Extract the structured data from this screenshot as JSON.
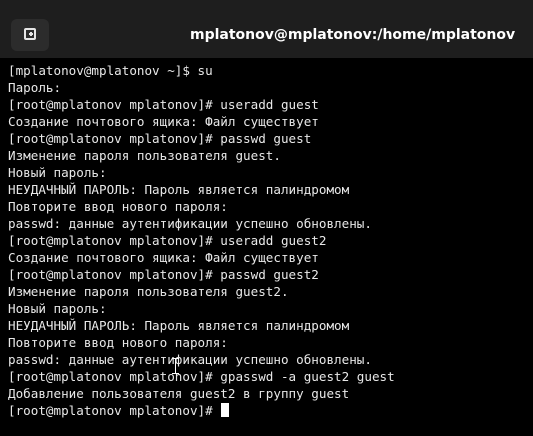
{
  "window": {
    "title": "mplatonov@mplatonov:/home/mplatonov",
    "new_tab_icon": "new-tab-icon"
  },
  "terminal": {
    "lines": [
      "[mplatonov@mplatonov ~]$ su",
      "Пароль:",
      "[root@mplatonov mplatonov]# useradd guest",
      "Создание почтового ящика: Файл существует",
      "[root@mplatonov mplatonov]# passwd guest",
      "Изменение пароля пользователя guest.",
      "Новый пароль:",
      "НЕУДАЧНЫЙ ПАРОЛЬ: Пароль является палиндромом",
      "Повторите ввод нового пароля:",
      "passwd: данные аутентификации успешно обновлены.",
      "[root@mplatonov mplatonov]# useradd guest2",
      "Создание почтового ящика: Файл существует",
      "[root@mplatonov mplatonov]# passwd guest2",
      "Изменение пароля пользователя guest2.",
      "Новый пароль:",
      "НЕУДАЧНЫЙ ПАРОЛЬ: Пароль является палиндромом",
      "Повторите ввод нового пароля:",
      "passwd: данные аутентификации успешно обновлены.",
      "[root@mplatonov mplatonov]# gpasswd -a guest2 guest",
      "Добавление пользователя guest2 в группу guest",
      "[root@mplatonov mplatonov]# "
    ]
  },
  "colors": {
    "background": "#000000",
    "titlebar": "#1e1e1e",
    "text": "#e8e8e8"
  }
}
